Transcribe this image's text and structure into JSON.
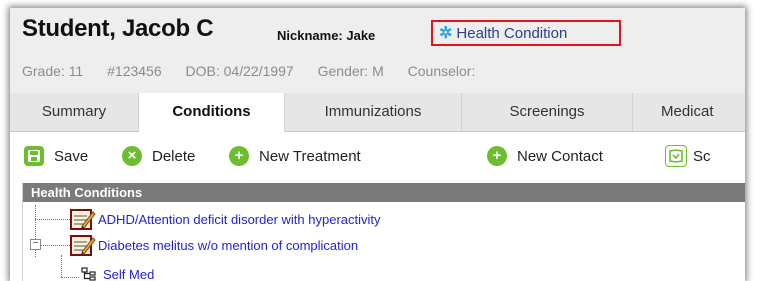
{
  "student": {
    "name": "Student, Jacob C",
    "nickname": "Nickname: Jake",
    "health_flag": "Health Condition",
    "grade": "Grade: 11",
    "id": "#123456",
    "dob": "DOB: 04/22/1997",
    "gender": "Gender: M",
    "counselor": "Counselor:"
  },
  "tabs": [
    "Summary",
    "Conditions",
    "Immunizations",
    "Screenings",
    "Medicat"
  ],
  "active_tab": "Conditions",
  "toolbar": {
    "save": "Save",
    "delete": "Delete",
    "new_treatment": "New Treatment",
    "new_contact": "New Contact",
    "schedule": "Sc"
  },
  "tree": {
    "header": "Health Conditions",
    "items": [
      {
        "label": "ADHD/Attention deficit disorder with hyperactivity"
      },
      {
        "label": "Diabetes melitus w/o mention of complication",
        "expander": "−"
      },
      {
        "label": "Self Med"
      }
    ]
  },
  "colors": {
    "accent_green": "#6cbe2f",
    "flag_border": "#e0141e",
    "link_blue": "#1f1fd8"
  }
}
